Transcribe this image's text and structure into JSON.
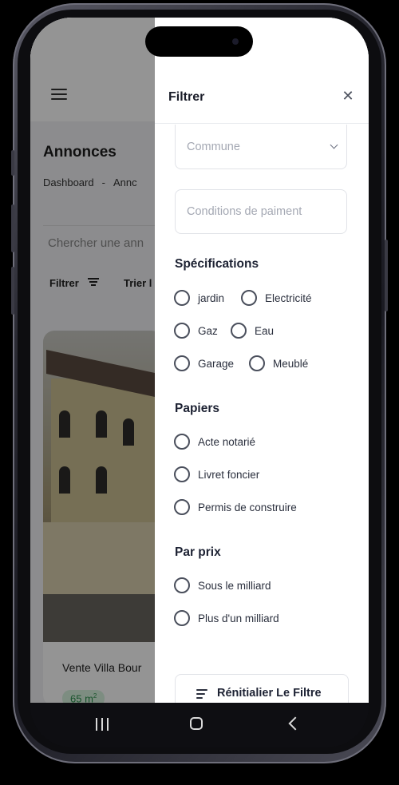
{
  "background": {
    "title": "Annonces",
    "breadcrumb": {
      "first": "Dashboard",
      "separator": "-",
      "second": "Annc"
    },
    "search_placeholder": "Chercher une ann",
    "filter_label": "Filtrer",
    "sort_label": "Trier l",
    "card": {
      "title": "Vente Villa Bour",
      "badge": "65 m",
      "badge_unit_sup": "2"
    }
  },
  "drawer": {
    "title": "Filtrer",
    "close_glyph": "✕",
    "commune_placeholder": "Commune",
    "conditions_placeholder": "Conditions de paiment",
    "sections": {
      "specifications": {
        "title": "Spécifications",
        "options": [
          "jardin",
          "Electricité",
          "Gaz",
          "Eau",
          "Garage",
          "Meublé"
        ]
      },
      "papiers": {
        "title": "Papiers",
        "options": [
          "Acte notarié",
          "Livret foncier",
          "Permis de construire"
        ]
      },
      "prix": {
        "title": "Par prix",
        "options": [
          "Sous le milliard",
          "Plus d'un milliard"
        ]
      }
    },
    "reset_label": "Rénitialier Le Filtre"
  },
  "icons": {
    "menu": "hamburger-icon",
    "close": "close-icon",
    "dropdown": "chevron-down-icon",
    "reset": "filter-lines-icon",
    "nav": [
      "recents-icon",
      "home-icon",
      "back-icon"
    ]
  },
  "colors": {
    "accent_text": "#1d2233",
    "muted_text": "#a4a8b3",
    "badge_green": "#2a8f4b"
  }
}
